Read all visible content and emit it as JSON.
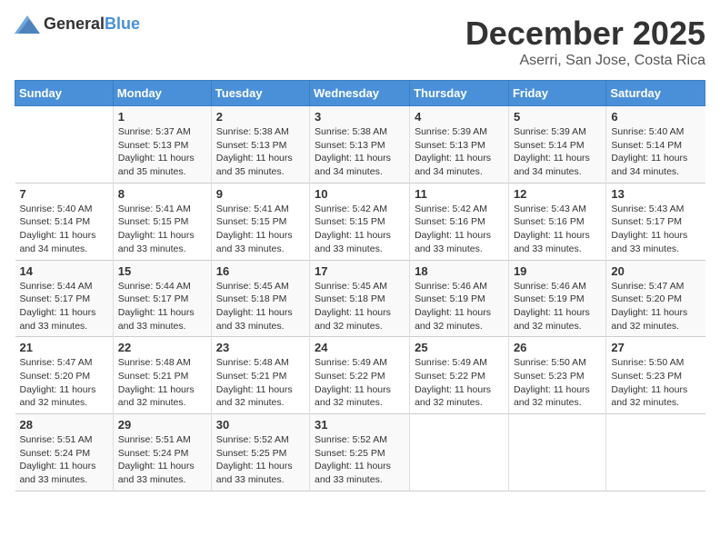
{
  "header": {
    "logo_general": "General",
    "logo_blue": "Blue",
    "month_title": "December 2025",
    "location": "Aserri, San Jose, Costa Rica"
  },
  "weekdays": [
    "Sunday",
    "Monday",
    "Tuesday",
    "Wednesday",
    "Thursday",
    "Friday",
    "Saturday"
  ],
  "weeks": [
    [
      {
        "day": "",
        "sunrise": "",
        "sunset": "",
        "daylight": ""
      },
      {
        "day": "1",
        "sunrise": "Sunrise: 5:37 AM",
        "sunset": "Sunset: 5:13 PM",
        "daylight": "Daylight: 11 hours and 35 minutes."
      },
      {
        "day": "2",
        "sunrise": "Sunrise: 5:38 AM",
        "sunset": "Sunset: 5:13 PM",
        "daylight": "Daylight: 11 hours and 35 minutes."
      },
      {
        "day": "3",
        "sunrise": "Sunrise: 5:38 AM",
        "sunset": "Sunset: 5:13 PM",
        "daylight": "Daylight: 11 hours and 34 minutes."
      },
      {
        "day": "4",
        "sunrise": "Sunrise: 5:39 AM",
        "sunset": "Sunset: 5:13 PM",
        "daylight": "Daylight: 11 hours and 34 minutes."
      },
      {
        "day": "5",
        "sunrise": "Sunrise: 5:39 AM",
        "sunset": "Sunset: 5:14 PM",
        "daylight": "Daylight: 11 hours and 34 minutes."
      },
      {
        "day": "6",
        "sunrise": "Sunrise: 5:40 AM",
        "sunset": "Sunset: 5:14 PM",
        "daylight": "Daylight: 11 hours and 34 minutes."
      }
    ],
    [
      {
        "day": "7",
        "sunrise": "Sunrise: 5:40 AM",
        "sunset": "Sunset: 5:14 PM",
        "daylight": "Daylight: 11 hours and 34 minutes."
      },
      {
        "day": "8",
        "sunrise": "Sunrise: 5:41 AM",
        "sunset": "Sunset: 5:15 PM",
        "daylight": "Daylight: 11 hours and 33 minutes."
      },
      {
        "day": "9",
        "sunrise": "Sunrise: 5:41 AM",
        "sunset": "Sunset: 5:15 PM",
        "daylight": "Daylight: 11 hours and 33 minutes."
      },
      {
        "day": "10",
        "sunrise": "Sunrise: 5:42 AM",
        "sunset": "Sunset: 5:15 PM",
        "daylight": "Daylight: 11 hours and 33 minutes."
      },
      {
        "day": "11",
        "sunrise": "Sunrise: 5:42 AM",
        "sunset": "Sunset: 5:16 PM",
        "daylight": "Daylight: 11 hours and 33 minutes."
      },
      {
        "day": "12",
        "sunrise": "Sunrise: 5:43 AM",
        "sunset": "Sunset: 5:16 PM",
        "daylight": "Daylight: 11 hours and 33 minutes."
      },
      {
        "day": "13",
        "sunrise": "Sunrise: 5:43 AM",
        "sunset": "Sunset: 5:17 PM",
        "daylight": "Daylight: 11 hours and 33 minutes."
      }
    ],
    [
      {
        "day": "14",
        "sunrise": "Sunrise: 5:44 AM",
        "sunset": "Sunset: 5:17 PM",
        "daylight": "Daylight: 11 hours and 33 minutes."
      },
      {
        "day": "15",
        "sunrise": "Sunrise: 5:44 AM",
        "sunset": "Sunset: 5:17 PM",
        "daylight": "Daylight: 11 hours and 33 minutes."
      },
      {
        "day": "16",
        "sunrise": "Sunrise: 5:45 AM",
        "sunset": "Sunset: 5:18 PM",
        "daylight": "Daylight: 11 hours and 33 minutes."
      },
      {
        "day": "17",
        "sunrise": "Sunrise: 5:45 AM",
        "sunset": "Sunset: 5:18 PM",
        "daylight": "Daylight: 11 hours and 32 minutes."
      },
      {
        "day": "18",
        "sunrise": "Sunrise: 5:46 AM",
        "sunset": "Sunset: 5:19 PM",
        "daylight": "Daylight: 11 hours and 32 minutes."
      },
      {
        "day": "19",
        "sunrise": "Sunrise: 5:46 AM",
        "sunset": "Sunset: 5:19 PM",
        "daylight": "Daylight: 11 hours and 32 minutes."
      },
      {
        "day": "20",
        "sunrise": "Sunrise: 5:47 AM",
        "sunset": "Sunset: 5:20 PM",
        "daylight": "Daylight: 11 hours and 32 minutes."
      }
    ],
    [
      {
        "day": "21",
        "sunrise": "Sunrise: 5:47 AM",
        "sunset": "Sunset: 5:20 PM",
        "daylight": "Daylight: 11 hours and 32 minutes."
      },
      {
        "day": "22",
        "sunrise": "Sunrise: 5:48 AM",
        "sunset": "Sunset: 5:21 PM",
        "daylight": "Daylight: 11 hours and 32 minutes."
      },
      {
        "day": "23",
        "sunrise": "Sunrise: 5:48 AM",
        "sunset": "Sunset: 5:21 PM",
        "daylight": "Daylight: 11 hours and 32 minutes."
      },
      {
        "day": "24",
        "sunrise": "Sunrise: 5:49 AM",
        "sunset": "Sunset: 5:22 PM",
        "daylight": "Daylight: 11 hours and 32 minutes."
      },
      {
        "day": "25",
        "sunrise": "Sunrise: 5:49 AM",
        "sunset": "Sunset: 5:22 PM",
        "daylight": "Daylight: 11 hours and 32 minutes."
      },
      {
        "day": "26",
        "sunrise": "Sunrise: 5:50 AM",
        "sunset": "Sunset: 5:23 PM",
        "daylight": "Daylight: 11 hours and 32 minutes."
      },
      {
        "day": "27",
        "sunrise": "Sunrise: 5:50 AM",
        "sunset": "Sunset: 5:23 PM",
        "daylight": "Daylight: 11 hours and 32 minutes."
      }
    ],
    [
      {
        "day": "28",
        "sunrise": "Sunrise: 5:51 AM",
        "sunset": "Sunset: 5:24 PM",
        "daylight": "Daylight: 11 hours and 33 minutes."
      },
      {
        "day": "29",
        "sunrise": "Sunrise: 5:51 AM",
        "sunset": "Sunset: 5:24 PM",
        "daylight": "Daylight: 11 hours and 33 minutes."
      },
      {
        "day": "30",
        "sunrise": "Sunrise: 5:52 AM",
        "sunset": "Sunset: 5:25 PM",
        "daylight": "Daylight: 11 hours and 33 minutes."
      },
      {
        "day": "31",
        "sunrise": "Sunrise: 5:52 AM",
        "sunset": "Sunset: 5:25 PM",
        "daylight": "Daylight: 11 hours and 33 minutes."
      },
      {
        "day": "",
        "sunrise": "",
        "sunset": "",
        "daylight": ""
      },
      {
        "day": "",
        "sunrise": "",
        "sunset": "",
        "daylight": ""
      },
      {
        "day": "",
        "sunrise": "",
        "sunset": "",
        "daylight": ""
      }
    ]
  ]
}
